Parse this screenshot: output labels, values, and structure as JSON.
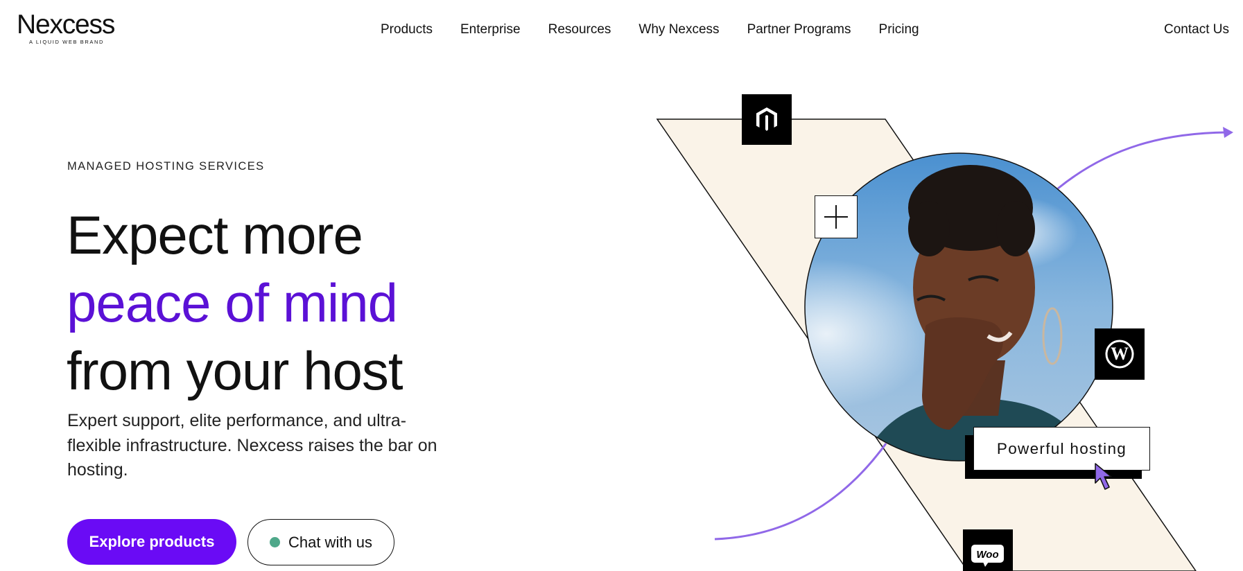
{
  "header": {
    "logo_word": "Nexcess",
    "logo_tagline": "A LIQUID WEB BRAND",
    "nav": [
      "Products",
      "Enterprise",
      "Resources",
      "Why Nexcess",
      "Partner Programs",
      "Pricing"
    ],
    "contact": "Contact Us"
  },
  "hero": {
    "eyebrow": "MANAGED HOSTING SERVICES",
    "headline_line1": "Expect more",
    "headline_line2": "peace of mind",
    "headline_line3": "from your host",
    "subtext": "Expert support, elite performance, and ultra-flexible infrastructure. Nexcess raises the bar on hosting.",
    "primary_cta": "Explore products",
    "secondary_cta": "Chat with us"
  },
  "illustration": {
    "callout": "Powerful hosting",
    "badges": [
      "magento-icon",
      "wordpress-icon",
      "woocommerce-icon",
      "plus-icon"
    ],
    "woo_text": "Woo"
  },
  "colors": {
    "accent_purple": "#5b11d6",
    "button_purple": "#6a0bf5",
    "arrow_purple": "#9068e8",
    "cream": "#faf3e8",
    "chat_dot": "#4fa88a"
  }
}
